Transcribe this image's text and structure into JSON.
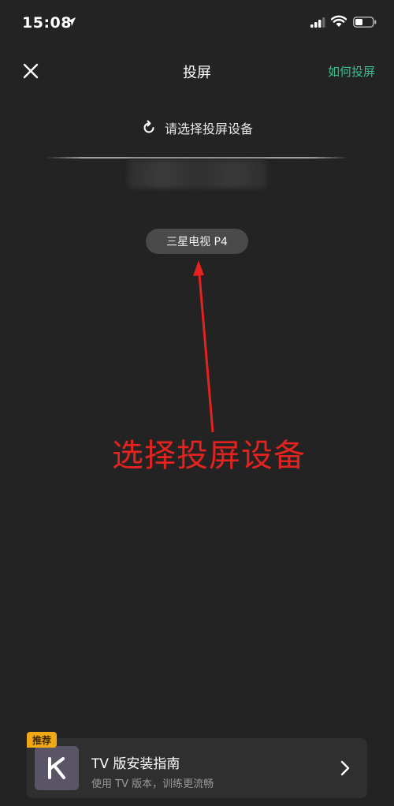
{
  "status_bar": {
    "time": "15:08"
  },
  "nav": {
    "title": "投屏",
    "help_link": "如何投屏"
  },
  "refresh": {
    "label": "请选择投屏设备"
  },
  "device": {
    "name": "三星电视 P4"
  },
  "annotation": {
    "text": "选择投屏设备"
  },
  "promo": {
    "badge": "推荐",
    "title": "TV 版安装指南",
    "subtitle": "使用 TV 版本，训练更流畅"
  },
  "colors": {
    "accent": "#35c18f",
    "annotation": "#e3231f",
    "badge": "#f0a817",
    "background": "#232323"
  }
}
